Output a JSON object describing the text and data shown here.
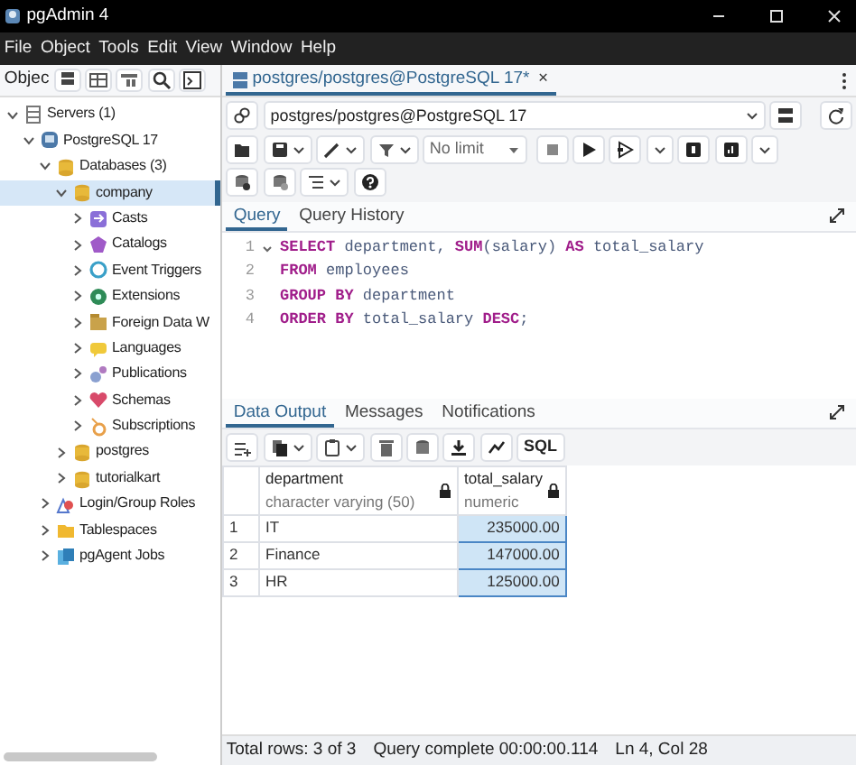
{
  "window": {
    "title": "pgAdmin 4"
  },
  "menu": [
    "File",
    "Object",
    "Tools",
    "Edit",
    "View",
    "Window",
    "Help"
  ],
  "object_explorer": {
    "title": "Objec",
    "tree": [
      {
        "label": "Servers (1)",
        "kind": "server-group",
        "expanded": true,
        "selected": false,
        "children": [
          {
            "label": "PostgreSQL 17",
            "kind": "server",
            "expanded": true,
            "selected": false,
            "children": [
              {
                "label": "Databases (3)",
                "kind": "databases",
                "expanded": true,
                "selected": false,
                "children": [
                  {
                    "label": "company",
                    "kind": "database",
                    "expanded": true,
                    "selected": true,
                    "children": [
                      {
                        "label": "Casts",
                        "kind": "casts",
                        "expanded": false,
                        "selected": false
                      },
                      {
                        "label": "Catalogs",
                        "kind": "catalogs",
                        "expanded": false,
                        "selected": false
                      },
                      {
                        "label": "Event Triggers",
                        "kind": "triggers",
                        "expanded": false,
                        "selected": false
                      },
                      {
                        "label": "Extensions",
                        "kind": "extensions",
                        "expanded": false,
                        "selected": false
                      },
                      {
                        "label": "Foreign Data W",
                        "kind": "foreign",
                        "expanded": false,
                        "selected": false
                      },
                      {
                        "label": "Languages",
                        "kind": "languages",
                        "expanded": false,
                        "selected": false
                      },
                      {
                        "label": "Publications",
                        "kind": "publications",
                        "expanded": false,
                        "selected": false
                      },
                      {
                        "label": "Schemas",
                        "kind": "schemas",
                        "expanded": false,
                        "selected": false
                      },
                      {
                        "label": "Subscriptions",
                        "kind": "subscriptions",
                        "expanded": false,
                        "selected": false
                      }
                    ]
                  },
                  {
                    "label": "postgres",
                    "kind": "database",
                    "expanded": false,
                    "selected": false
                  },
                  {
                    "label": "tutorialkart",
                    "kind": "database",
                    "expanded": false,
                    "selected": false
                  }
                ]
              },
              {
                "label": "Login/Group Roles",
                "kind": "roles",
                "expanded": false,
                "selected": false
              },
              {
                "label": "Tablespaces",
                "kind": "tablespaces",
                "expanded": false,
                "selected": false
              },
              {
                "label": "pgAgent Jobs",
                "kind": "jobs",
                "expanded": false,
                "selected": false
              }
            ]
          }
        ]
      }
    ]
  },
  "query_tool": {
    "tab": {
      "label": "postgres/postgres@PostgreSQL 17*",
      "selected": true,
      "close": "×"
    },
    "connection": "postgres/postgres@PostgreSQL 17",
    "limit": "No limit",
    "editor_tabs": [
      {
        "label": "Query",
        "selected": true
      },
      {
        "label": "Query History",
        "selected": false
      }
    ],
    "code": [
      {
        "number": "1",
        "tokens": [
          {
            "text": "SELECT",
            "kind": "keyword"
          },
          {
            "text": " department, ",
            "kind": "ident"
          },
          {
            "text": "SUM",
            "kind": "keyword"
          },
          {
            "text": "(salary) ",
            "kind": "ident"
          },
          {
            "text": "AS",
            "kind": "keyword"
          },
          {
            "text": " total_salary",
            "kind": "ident"
          }
        ]
      },
      {
        "number": "2",
        "tokens": [
          {
            "text": "FROM",
            "kind": "keyword"
          },
          {
            "text": " employees",
            "kind": "ident"
          }
        ]
      },
      {
        "number": "3",
        "tokens": [
          {
            "text": "GROUP BY",
            "kind": "keyword"
          },
          {
            "text": " department",
            "kind": "ident"
          }
        ]
      },
      {
        "number": "4",
        "tokens": [
          {
            "text": "ORDER BY",
            "kind": "keyword"
          },
          {
            "text": " total_salary ",
            "kind": "ident"
          },
          {
            "text": "DESC",
            "kind": "keyword"
          },
          {
            "text": ";",
            "kind": "ident"
          }
        ]
      }
    ],
    "output_tabs": [
      {
        "label": "Data Output",
        "selected": true
      },
      {
        "label": "Messages",
        "selected": false
      },
      {
        "label": "Notifications",
        "selected": false
      }
    ],
    "sql_button": "SQL",
    "grid": {
      "columns": [
        {
          "name": "department",
          "type": "character varying (50)",
          "selected": false
        },
        {
          "name": "total_salary",
          "type": "numeric",
          "selected": true
        }
      ],
      "rows": [
        {
          "number": "1",
          "cells": [
            "IT",
            "235000.00"
          ]
        },
        {
          "number": "2",
          "cells": [
            "Finance",
            "147000.00"
          ]
        },
        {
          "number": "3",
          "cells": [
            "HR",
            "125000.00"
          ]
        }
      ]
    },
    "status_bar": [
      "Total rows: 3 of 3",
      "Query complete 00:00:00.114",
      "Ln 4, Col 28"
    ]
  }
}
